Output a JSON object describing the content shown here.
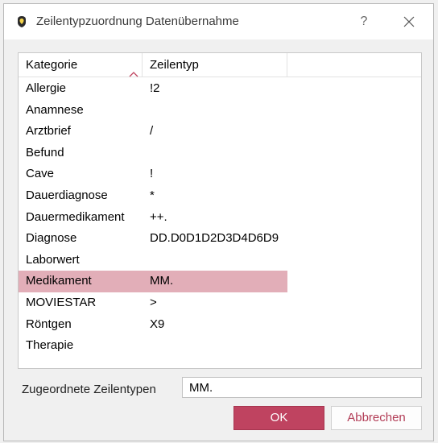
{
  "window": {
    "title": "Zeilentypzuordnung Datenübernahme",
    "help_label": "?",
    "icons": {
      "app": "shield-icon",
      "close": "close-icon",
      "sort": "sort-ascending-icon"
    }
  },
  "table": {
    "columns": [
      "Kategorie",
      "Zeilentyp"
    ],
    "rows": [
      {
        "kategorie": "Allergie",
        "zeilentyp": "!2"
      },
      {
        "kategorie": "Anamnese",
        "zeilentyp": ""
      },
      {
        "kategorie": "Arztbrief",
        "zeilentyp": "/"
      },
      {
        "kategorie": "Befund",
        "zeilentyp": ""
      },
      {
        "kategorie": "Cave",
        "zeilentyp": "!"
      },
      {
        "kategorie": "Dauerdiagnose",
        "zeilentyp": "*"
      },
      {
        "kategorie": "Dauermedikament",
        "zeilentyp": "++."
      },
      {
        "kategorie": "Diagnose",
        "zeilentyp": "DD.D0D1D2D3D4D6D9"
      },
      {
        "kategorie": "Laborwert",
        "zeilentyp": ""
      },
      {
        "kategorie": "Medikament",
        "zeilentyp": "MM.",
        "selected": true
      },
      {
        "kategorie": "MOVIESTAR",
        "zeilentyp": ">"
      },
      {
        "kategorie": "Röntgen",
        "zeilentyp": "X9"
      },
      {
        "kategorie": "Therapie",
        "zeilentyp": ""
      }
    ]
  },
  "assigned": {
    "label": "Zugeordnete Zeilentypen",
    "value": "MM."
  },
  "buttons": {
    "ok": "OK",
    "cancel": "Abbrechen"
  },
  "colors": {
    "accent": "#bf4360",
    "selection": "#e2aeb8",
    "cancel_text": "#b23c56"
  }
}
